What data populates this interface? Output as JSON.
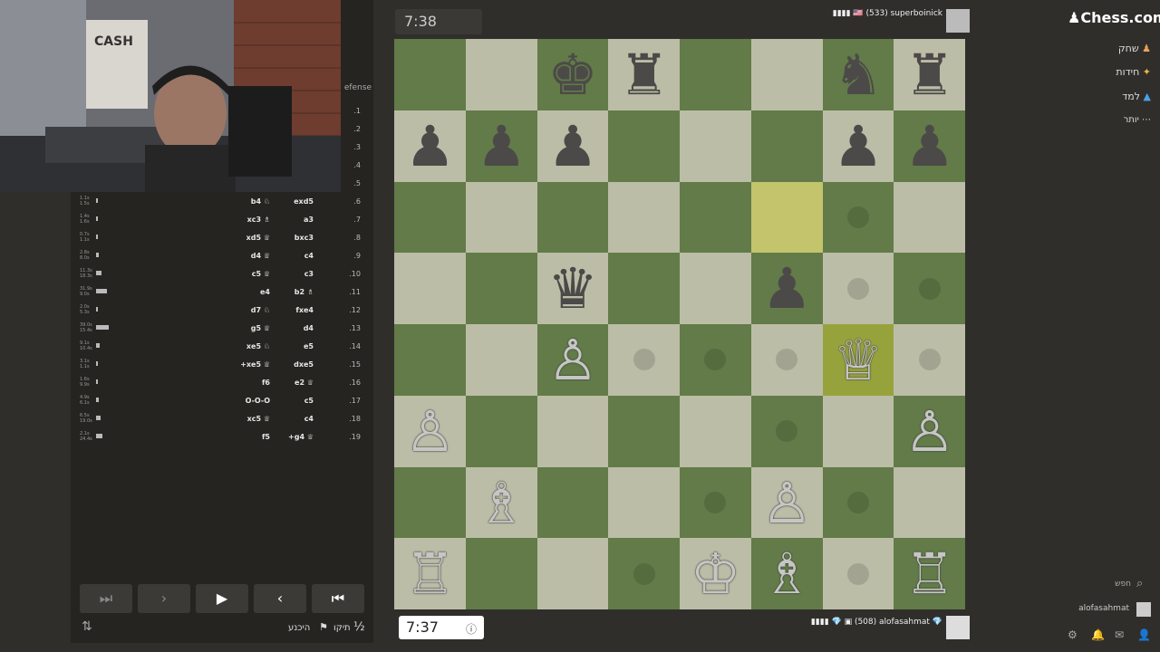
{
  "opening": "efense",
  "moves": [
    {
      "num": ".1",
      "white": "",
      "black": "",
      "t1": "",
      "t2": "",
      "bar": 0
    },
    {
      "num": ".2",
      "white": "",
      "black": "",
      "t1": "",
      "t2": "",
      "bar": 0
    },
    {
      "num": ".3",
      "white": "",
      "black": "",
      "t1": "",
      "t2": "",
      "bar": 0
    },
    {
      "num": ".4",
      "white": "",
      "black": "",
      "t1": "",
      "t2": "",
      "bar": 0
    },
    {
      "num": ".5",
      "white": "",
      "black": "",
      "t1": "",
      "t2": "",
      "bar": 0
    },
    {
      "num": ".6",
      "white": "b4 ♘",
      "black": "exd5",
      "t1": "1.1s",
      "t2": "1.5s",
      "bar": 2
    },
    {
      "num": ".7",
      "white": "xc3 ♗",
      "black": "a3",
      "t1": "1.4s",
      "t2": "1.6s",
      "bar": 2
    },
    {
      "num": ".8",
      "white": "xd5 ♕",
      "black": "bxc3",
      "t1": "0.7s",
      "t2": "1.1s",
      "bar": 2
    },
    {
      "num": ".9",
      "white": "d4 ♕",
      "black": "c4",
      "t1": "2.8s",
      "t2": "8.0s",
      "bar": 3
    },
    {
      "num": ".10",
      "white": "c5 ♕",
      "black": "c3",
      "t1": "11.3s",
      "t2": "18.3s",
      "bar": 6
    },
    {
      "num": ".11",
      "white": "e4",
      "black": "b2 ♗",
      "t1": "31.9s",
      "t2": "9.0s",
      "bar": 12
    },
    {
      "num": ".12",
      "white": "d7 ♘",
      "black": "fxe4",
      "t1": "2.0s",
      "t2": "5.3s",
      "bar": 2
    },
    {
      "num": ".13",
      "white": "g5 ♕",
      "black": "d4",
      "t1": "39.0s",
      "t2": "15.4s",
      "bar": 14
    },
    {
      "num": ".14",
      "white": "xe5 ♘",
      "black": "e5",
      "t1": "9.1s",
      "t2": "10.4s",
      "bar": 4
    },
    {
      "num": ".15",
      "white": "+xe5 ♕",
      "black": "dxe5",
      "t1": "3.1s",
      "t2": "1.1s",
      "bar": 2
    },
    {
      "num": ".16",
      "white": "f6",
      "black": "e2 ♕",
      "t1": "1.6s",
      "t2": "9.9s",
      "bar": 2
    },
    {
      "num": ".17",
      "white": "O-O-O",
      "black": "c5",
      "t1": "4.9s",
      "t2": "6.1s",
      "bar": 3
    },
    {
      "num": ".18",
      "white": "xc5 ♕",
      "black": "c4",
      "t1": "6.5s",
      "t2": "19.0s",
      "bar": 5
    },
    {
      "num": ".19",
      "white": "f5",
      "black": "+g4 ♕",
      "t1": "2.1s",
      "t2": "24.4s",
      "bar": 7
    }
  ],
  "controls": {
    "last": "⏭",
    "next": "›",
    "play": "▶",
    "prev": "‹",
    "first": "⏮"
  },
  "bottom_actions": {
    "flip": "⇅",
    "resign": "היכנע",
    "abort": "תיקו",
    "half": "½"
  },
  "top_clock": "7:38",
  "top_player": "▮▮▮▮ 🇺🇸 (533) superboinick",
  "bottom_clock": "7:37",
  "bottom_player": "▮▮▮▮ 💎 ▣ (508) alofasahmat 💎",
  "board": {
    "files": [
      "a",
      "b",
      "c",
      "d",
      "e",
      "f",
      "g",
      "h"
    ],
    "ranks": [
      "8",
      "7",
      "6",
      "5",
      "4",
      "3",
      "2",
      "1"
    ],
    "pieces": [
      {
        "sq": "c8",
        "glyph": "♚",
        "color": "b"
      },
      {
        "sq": "d8",
        "glyph": "♜",
        "color": "b"
      },
      {
        "sq": "g8",
        "glyph": "♞",
        "color": "b"
      },
      {
        "sq": "h8",
        "glyph": "♜",
        "color": "b"
      },
      {
        "sq": "a7",
        "glyph": "♟",
        "color": "b"
      },
      {
        "sq": "b7",
        "glyph": "♟",
        "color": "b"
      },
      {
        "sq": "c7",
        "glyph": "♟",
        "color": "b"
      },
      {
        "sq": "g7",
        "glyph": "♟",
        "color": "b"
      },
      {
        "sq": "h7",
        "glyph": "♟",
        "color": "b"
      },
      {
        "sq": "c5",
        "glyph": "♛",
        "color": "b"
      },
      {
        "sq": "f5",
        "glyph": "♟",
        "color": "b"
      },
      {
        "sq": "c4",
        "glyph": "♙",
        "color": "w"
      },
      {
        "sq": "g4",
        "glyph": "♕",
        "color": "w"
      },
      {
        "sq": "a3",
        "glyph": "♙",
        "color": "w"
      },
      {
        "sq": "h3",
        "glyph": "♙",
        "color": "w"
      },
      {
        "sq": "b2",
        "glyph": "♗",
        "color": "w"
      },
      {
        "sq": "f2",
        "glyph": "♙",
        "color": "w"
      },
      {
        "sq": "a1",
        "glyph": "♖",
        "color": "w"
      },
      {
        "sq": "e1",
        "glyph": "♔",
        "color": "w"
      },
      {
        "sq": "f1",
        "glyph": "♗",
        "color": "w"
      },
      {
        "sq": "h1",
        "glyph": "♖",
        "color": "w"
      }
    ],
    "highlights": [
      "f6",
      "g4"
    ],
    "dots": [
      "g6",
      "g5",
      "h5",
      "d4",
      "e4",
      "f4",
      "h4",
      "f3",
      "e2",
      "g2",
      "d1",
      "g1"
    ]
  },
  "nav": {
    "logo": "♟Chess.com",
    "play": "שחק",
    "puzzles": "חידות",
    "learn": "למד",
    "more": "יותר"
  },
  "search": "חפש",
  "username": "alofasahmat"
}
